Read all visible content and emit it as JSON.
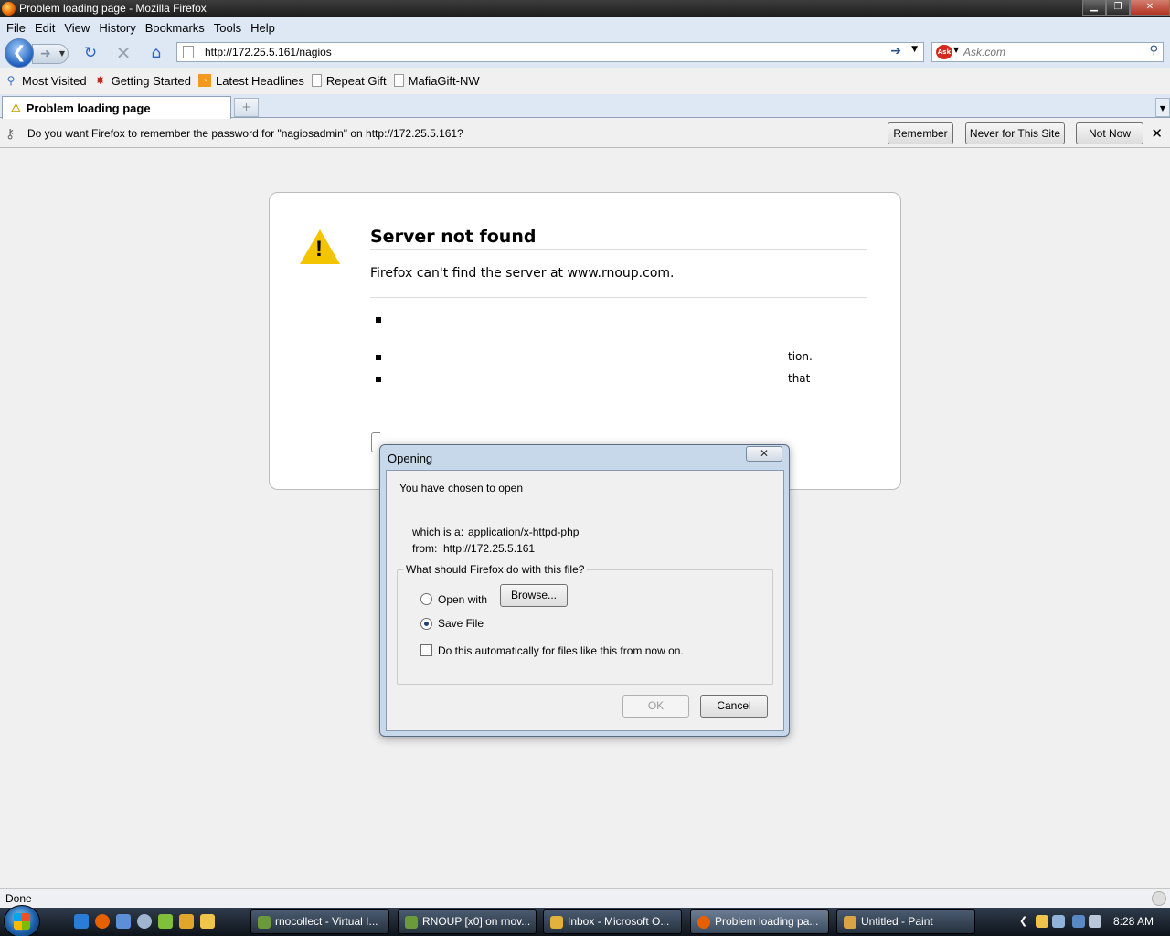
{
  "window": {
    "title": "Problem loading page - Mozilla Firefox",
    "controls": {
      "minimize": "▁",
      "maximize": "❐",
      "close": "✕"
    }
  },
  "menubar": {
    "items": [
      "File",
      "Edit",
      "View",
      "History",
      "Bookmarks",
      "Tools",
      "Help"
    ]
  },
  "navbar": {
    "url": "http://172.25.5.161/nagios",
    "search_placeholder": "Ask.com",
    "search_engine_badge": "Ask"
  },
  "bookmarks": [
    {
      "label": "Most Visited",
      "icon": "bookmark-folder-icon"
    },
    {
      "label": "Getting Started",
      "icon": "firefox-icon"
    },
    {
      "label": "Latest Headlines",
      "icon": "rss-icon"
    },
    {
      "label": "Repeat Gift",
      "icon": "page-icon"
    },
    {
      "label": "MafiaGift-NW",
      "icon": "page-icon"
    }
  ],
  "tabs": [
    {
      "label": "Problem loading page",
      "active": true
    }
  ],
  "notification": {
    "message": "Do you want Firefox to remember the password for \"nagiosadmin\" on http://172.25.5.161?",
    "buttons": {
      "remember": "Remember",
      "never": "Never for This Site",
      "not_now": "Not Now"
    }
  },
  "error_page": {
    "title": "Server not found",
    "description": "Firefox can't find the server at www.rnoup.com.",
    "fragment_1": "tion.",
    "fragment_2": "that"
  },
  "dialog": {
    "title": "Opening",
    "intro": "You have chosen to open",
    "type_label": "which is a:",
    "type_value": "application/x-httpd-php",
    "from_label": "from:",
    "from_value": "http://172.25.5.161",
    "group_label": "What should Firefox do with this file?",
    "open_with_label": "Open with",
    "browse_label": "Browse...",
    "save_file_label": "Save File",
    "auto_label": "Do this automatically for files like this from now on.",
    "ok_label": "OK",
    "cancel_label": "Cancel",
    "selected_option": "save_file",
    "auto_checked": false
  },
  "statusbar": {
    "text": "Done"
  },
  "taskbar": {
    "tasks": [
      {
        "label": "rnocollect - Virtual I...",
        "icon_color": "#6a9a3a"
      },
      {
        "label": "RNOUP [x0] on rnov...",
        "icon_color": "#6a9a3a"
      },
      {
        "label": "Inbox - Microsoft O...",
        "icon_color": "#e3b23c"
      },
      {
        "label": "Problem loading pa...",
        "icon_color": "#e66000",
        "active": true
      },
      {
        "label": "Untitled - Paint",
        "icon_color": "#d9a441"
      }
    ],
    "clock": "8:28 AM"
  },
  "colors": {
    "chrome_blue": "#dde8f4",
    "warning_yellow": "#f3c400",
    "dialog_frame": "#c7d8ea"
  }
}
